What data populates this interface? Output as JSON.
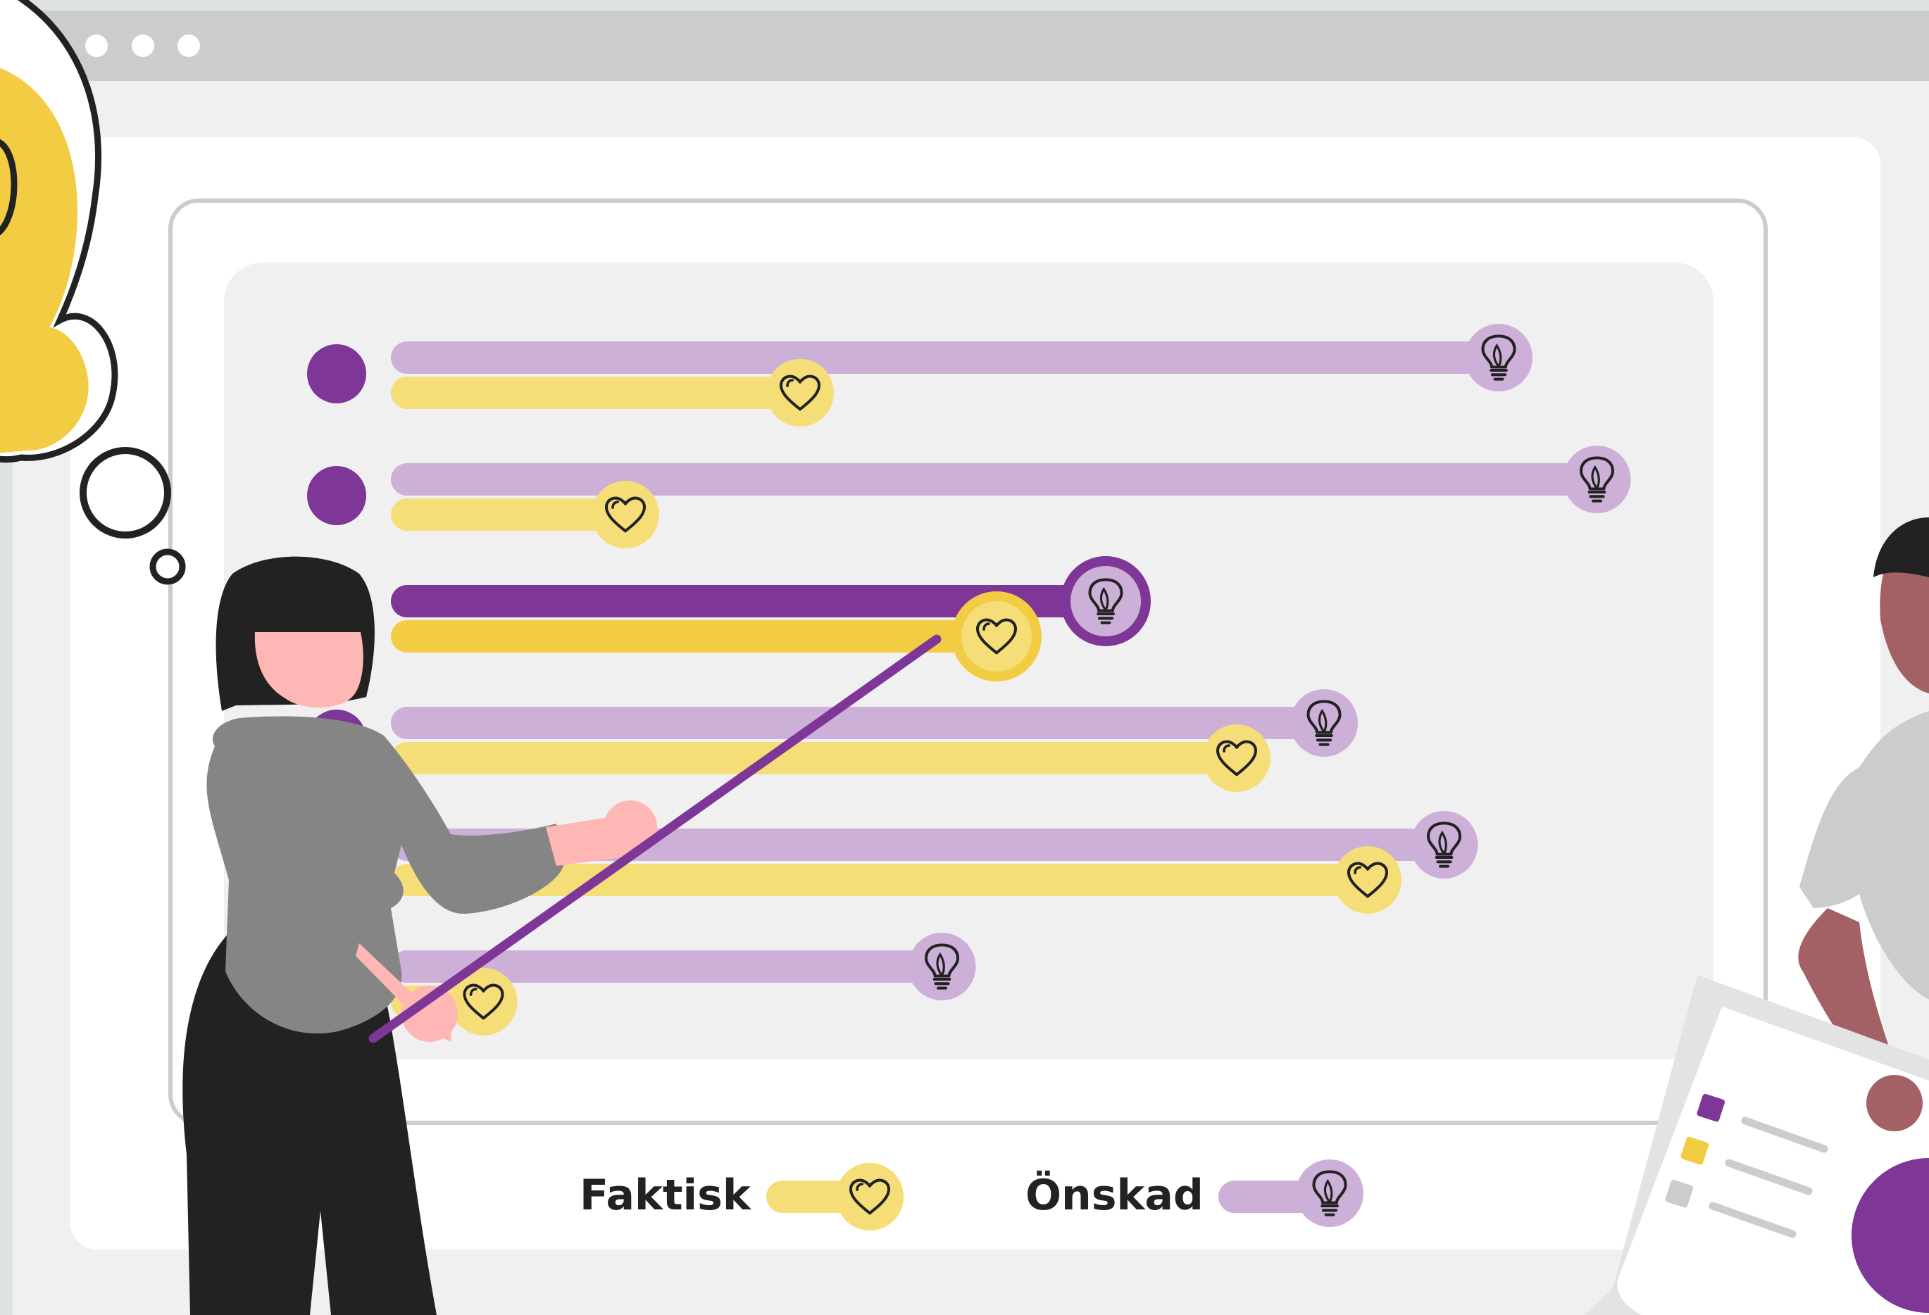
{
  "legend": {
    "actual_label": "Faktisk",
    "desired_label": "Önskad",
    "actual_icon": "heart-icon",
    "desired_icon": "lightbulb-icon"
  },
  "colors": {
    "actual": "#f5de78",
    "actual_highlight": "#f2cc43",
    "desired": "#cdb0d7",
    "desired_highlight": "#7e3697",
    "bullet": "#7e3697",
    "browser_bar": "#cccccc",
    "panel": "#f1f0f1"
  },
  "chart_data": {
    "type": "bar",
    "rows": [
      {
        "actual": 0.36,
        "desired": 1.0,
        "highlighted": false
      },
      {
        "actual": 0.2,
        "desired": 1.09,
        "highlighted": false
      },
      {
        "actual": 0.54,
        "desired": 0.64,
        "highlighted": true
      },
      {
        "actual": 0.76,
        "desired": 0.84,
        "highlighted": false
      },
      {
        "actual": 0.88,
        "desired": 0.95,
        "highlighted": false
      },
      {
        "actual": 0.07,
        "desired": 0.49,
        "highlighted": false
      }
    ]
  }
}
